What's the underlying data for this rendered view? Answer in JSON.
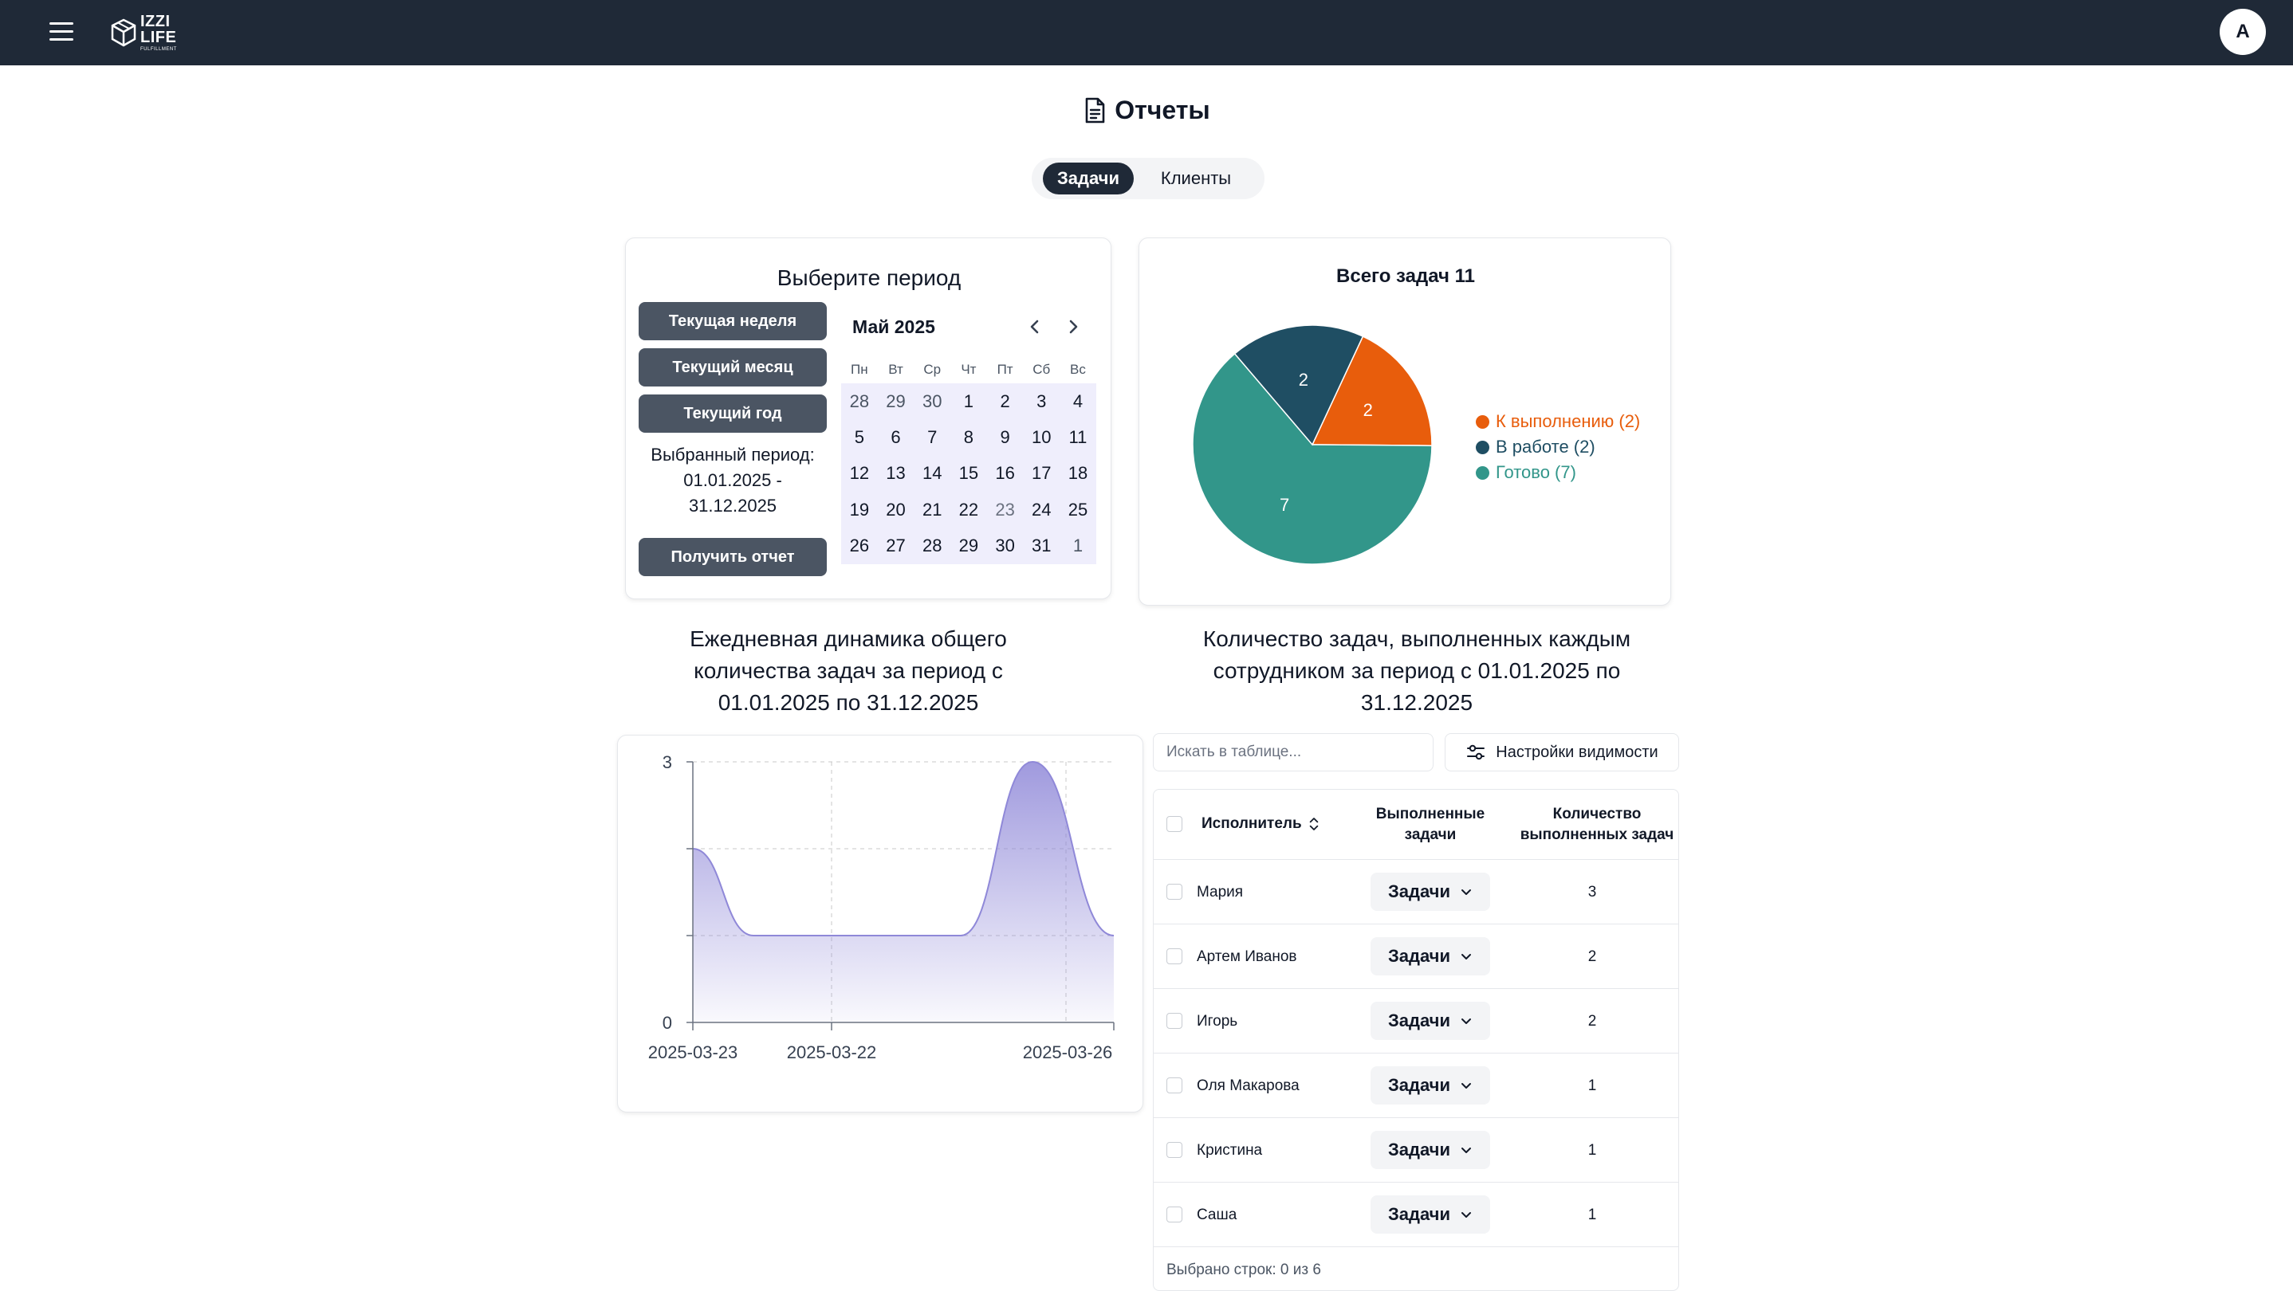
{
  "header": {
    "logo": {
      "line1": "IZZI",
      "line2": "LIFE",
      "line3": "FULFILLMENT"
    },
    "avatar_initial": "A"
  },
  "page": {
    "title": "Отчеты"
  },
  "tabs": [
    {
      "label": "Задачи",
      "active": true
    },
    {
      "label": "Клиенты",
      "active": false
    }
  ],
  "period": {
    "title": "Выберите период",
    "buttons": [
      "Текущая неделя",
      "Текущий месяц",
      "Текущий год"
    ],
    "selected_label": "Выбранный период:",
    "selected_range": "01.01.2025 - 31.12.2025",
    "submit": "Получить отчет",
    "calendar": {
      "month": "Май 2025",
      "weekdays": [
        "Пн",
        "Вт",
        "Ср",
        "Чт",
        "Пт",
        "Сб",
        "Вс"
      ],
      "days": [
        [
          "28",
          "29",
          "30",
          "1",
          "2",
          "3",
          "4"
        ],
        [
          "5",
          "6",
          "7",
          "8",
          "9",
          "10",
          "11"
        ],
        [
          "12",
          "13",
          "14",
          "15",
          "16",
          "17",
          "18"
        ],
        [
          "19",
          "20",
          "21",
          "22",
          "23",
          "24",
          "25"
        ],
        [
          "26",
          "27",
          "28",
          "29",
          "30",
          "31",
          "1"
        ]
      ]
    }
  },
  "pie": {
    "title": "Всего задач 11",
    "colors": {
      "todo": "#e85d0c",
      "in_progress": "#1f4e63",
      "done": "#32968a"
    },
    "slices": [
      {
        "label": "К выполнению (2)",
        "value": 2,
        "color": "#e85d0c"
      },
      {
        "label": "В работе (2)",
        "value": 2,
        "color": "#1f4e63"
      },
      {
        "label": "Готово (7)",
        "value": 7,
        "color": "#32968a"
      }
    ]
  },
  "line_section": {
    "title": "Ежедневная динамика общего количества задач за период с 01.01.2025 по 31.12.2025"
  },
  "table_section": {
    "title": "Количество задач, выполненных каждым сотрудником за период с 01.01.2025 по 31.12.2025",
    "search_placeholder": "Искать в таблице...",
    "visibility_button": "Настройки видимости",
    "columns": [
      "Исполнитель",
      "Выполненные задачи",
      "Количество выполненных задач"
    ],
    "rows": [
      {
        "name": "Мария",
        "tasks": "Задачи",
        "count": "3"
      },
      {
        "name": "Артем Иванов",
        "tasks": "Задачи",
        "count": "2"
      },
      {
        "name": "Игорь",
        "tasks": "Задачи",
        "count": "2"
      },
      {
        "name": "Оля Макарова",
        "tasks": "Задачи",
        "count": "1"
      },
      {
        "name": "Кристина",
        "tasks": "Задачи",
        "count": "1"
      },
      {
        "name": "Саша",
        "tasks": "Задачи",
        "count": "1"
      }
    ],
    "footer": "Выбрано строк: 0 из 6"
  },
  "chart_data": [
    {
      "type": "pie",
      "title": "Всего задач 11",
      "categories": [
        "К выполнению (2)",
        "В работе (2)",
        "Готово (7)"
      ],
      "values": [
        2,
        2,
        7
      ],
      "legend": "right"
    },
    {
      "type": "area",
      "title": "Ежедневная динамика общего количества задач за период с 01.01.2025 по 31.12.2025",
      "x": [
        "2025-03-23",
        "2025-03-22",
        "2025-03-26"
      ],
      "tick_labels": [
        "2025-03-23",
        "2025-03-22",
        "2025-03-26"
      ],
      "y_ticks": [
        "0",
        "3"
      ],
      "series": [
        {
          "values": [
            2,
            1,
            1,
            1,
            3,
            1
          ]
        }
      ],
      "ylim": [
        0,
        3
      ],
      "grid": true,
      "color": "#8f88d8"
    }
  ]
}
